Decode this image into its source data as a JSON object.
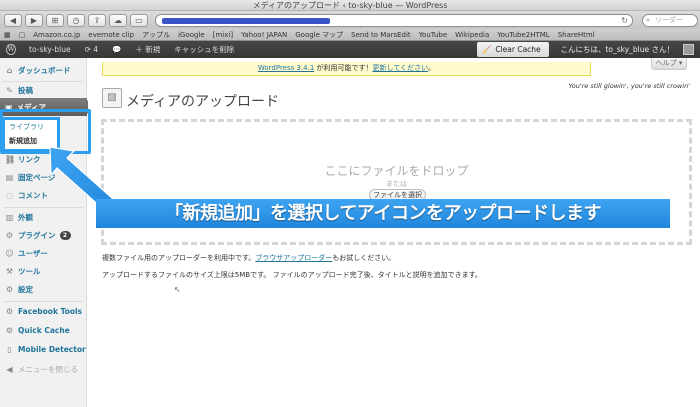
{
  "window": {
    "title": "メディアのアップロード ‹ to-sky-blue — WordPress"
  },
  "browser": {
    "forward_label": "▶",
    "back_label": "◀",
    "search_placeholder": "リーダー",
    "bookmarks": [
      "Amazon.co.jp",
      "evernote clip",
      "アップル",
      "iGoogle",
      "[mixi]",
      "Yahoo! JAPAN",
      "Google マップ",
      "Send to MarsEdit",
      "YouTube",
      "Wikipedia",
      "YouTube2HTML",
      "ShareHtml"
    ]
  },
  "adminbar": {
    "site_name": "to-sky-blue",
    "updates_count": "4",
    "new_label": "＋ 新規",
    "clear_cache_button": "Clear Cache",
    "delete_cache_label": "キャッシュを削除",
    "greeting": "こんにちは、to_sky_blue さん！"
  },
  "sidebar": {
    "dashboard": "ダッシュボード",
    "posts": "投稿",
    "media": "メディア",
    "media_library": "ライブラリ",
    "media_add_new": "新規追加",
    "links": "リンク",
    "pages": "固定ページ",
    "comments": "コメント",
    "appearance": "外観",
    "plugins": "プラグイン",
    "plugins_badge": "2",
    "users": "ユーザー",
    "tools": "ツール",
    "settings": "設定",
    "facebook_tools": "Facebook Tools",
    "quick_cache": "Quick Cache",
    "mobile_detector": "Mobile Detector",
    "collapse_menu": "メニューを閉じる"
  },
  "content": {
    "update_notice_version": "WordPress 3.4.1",
    "update_notice_mid": " が利用可能です！",
    "update_notice_link": "更新してください",
    "update_notice_end": "。",
    "help_tab": "ヘルプ ▾",
    "hello_dolly": "You're still glowin', you're still crowin'",
    "page_title": "メディアのアップロード",
    "drop_text": "ここにファイルをドロップ",
    "or_text": "または",
    "select_files_button": "ファイルを選択",
    "multi_uploader_prefix": "複数ファイル用のアップローダーを利用中です。",
    "browser_uploader_link": "ブラウザアップローダー",
    "multi_uploader_suffix": "もお試しください。",
    "max_size_text": "アップロードするファイルのサイズ上限は5MBです。 ファイルのアップロード完了後、タイトルと説明を追加できます。"
  },
  "annotation": {
    "text": "「新規追加」を選択してアイコンをアップロードします",
    "color": "#2d9ded"
  }
}
